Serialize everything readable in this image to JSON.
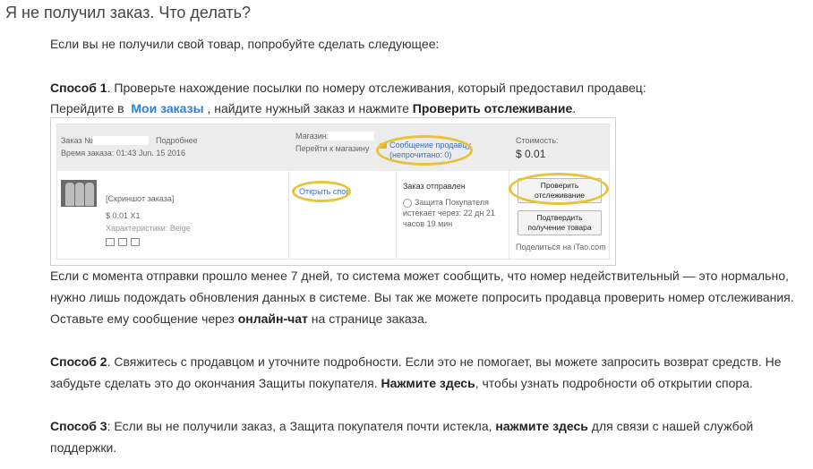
{
  "page_title": "Я не получил заказ. Что делать?",
  "intro": "Если вы не получили свой товар, попробуйте сделать следующее:",
  "way1": {
    "label": "Способ 1",
    "text": ". Проверьте нахождение посылки по номеру отслеживания, который предоставил продавец:",
    "go_prefix": "Перейдите в ",
    "link": "Мои заказы",
    "go_middle": " , найдите нужный заказ и нажмите ",
    "action": "Проверить отслеживание",
    "go_suffix": "."
  },
  "screenshot": {
    "order_no_label": "Заказ №:",
    "details": "Подробнее",
    "order_time": "Время заказа: 01:43 Jun. 15 2016",
    "shop_label": "Магазин:",
    "go_shop": "Перейти к магазину",
    "message_seller": "Сообщение продавцу",
    "unread": "(непрочитано: 0)",
    "cost_label": "Стоимость:",
    "cost_value": "$ 0.01",
    "product_name": "[Скриншот заказа]",
    "price_qty": "$ 0.01 X1",
    "properties": "Характеристики: Beige",
    "open_dispute": "Открыть спор",
    "order_sent": "Заказ отправлен",
    "buyer_protection": "Защита Покупателя",
    "expires_in": "истекает через: 22 дн 21",
    "hours_min": "часов 19 мин",
    "check_tracking_1": "Проверить",
    "check_tracking_2": "отслеживание",
    "confirm_1": "Подтвердить",
    "confirm_2": "получение товара",
    "share": "Поделиться на iTao.com",
    "accent": "#e8c33a"
  },
  "para2": {
    "l1": "Если с момента отправки прошло менее 7 дней, то система может сообщить, что номер недействительный — это нормально,",
    "l2": "нужно лишь подождать обновления данных в системе. Вы так же можете попросить продавца проверить номер отслеживания.",
    "l3_prefix": "Оставьте ему сообщение через ",
    "l3_bold": "онлайн-чат",
    "l3_suffix": " на странице заказа."
  },
  "way2": {
    "label": "Способ 2",
    "l1": ". Свяжитесь с продавцом и уточните подробности. Если это не помогает, вы можете запросить возврат средств. Не",
    "l2_prefix": "забудьте сделать это до окончания Защиты покупателя. ",
    "l2_bold": "Нажмите здесь",
    "l2_suffix": ", чтобы узнать подробности об открытии спора."
  },
  "way3": {
    "label": "Способ 3",
    "l1_prefix": ":  Если вы не получили заказ, а Защита покупателя почти истекла, ",
    "l1_bold": "нажмите здесь",
    "l1_suffix": " для связи с нашей службой",
    "l2": "поддержки."
  }
}
